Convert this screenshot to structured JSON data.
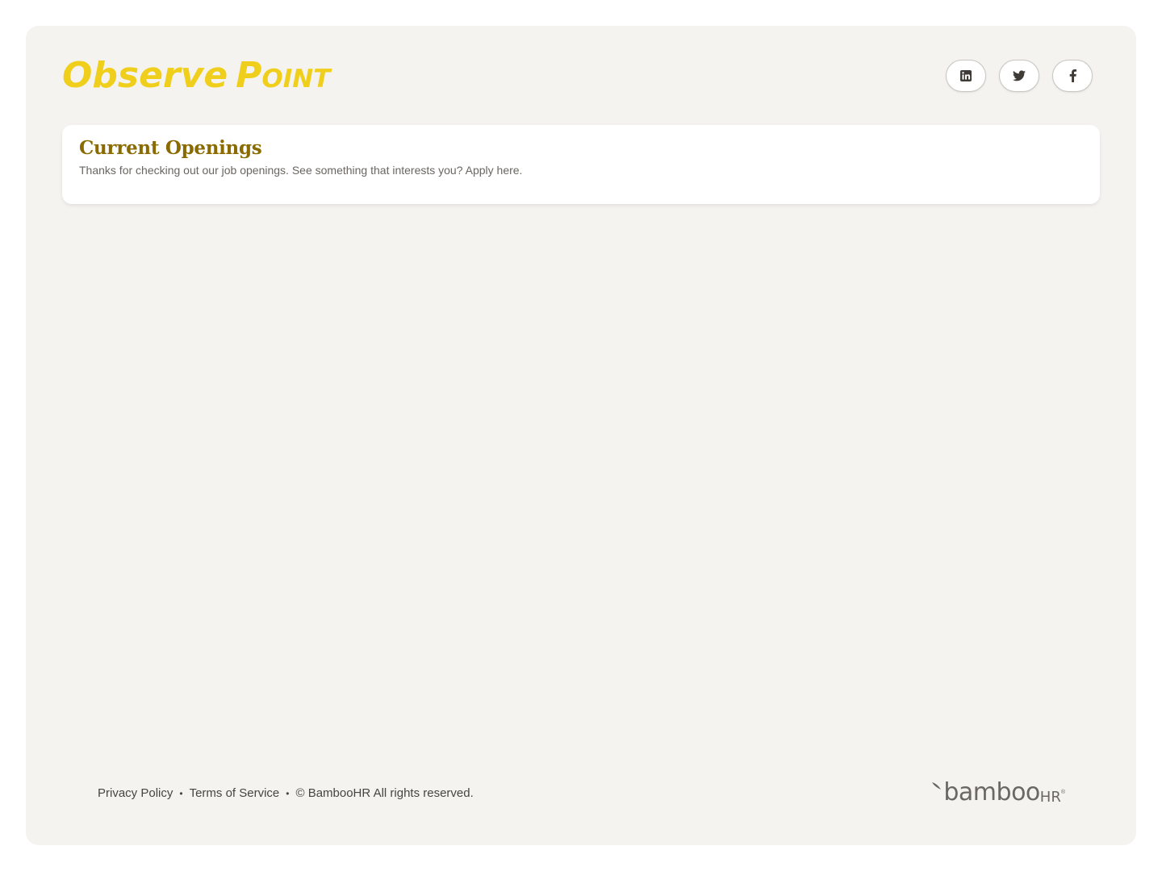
{
  "header": {
    "logo_word1": "Observe",
    "logo_word2": "Point",
    "social": [
      {
        "icon": "linkedin-icon"
      },
      {
        "icon": "twitter-icon"
      },
      {
        "icon": "facebook-icon"
      }
    ]
  },
  "openings": {
    "title": "Current Openings",
    "subtitle": "Thanks for checking out our job openings. See something that interests you? Apply here."
  },
  "footer": {
    "privacy": "Privacy Policy",
    "terms": "Terms of Service",
    "copyright": "© BambooHR All rights reserved.",
    "separator": "•",
    "brand_main": "bamboo",
    "brand_suffix": "HR",
    "brand_mark": "®"
  },
  "colors": {
    "brand_yellow": "#f0cf1c",
    "title_gold": "#8a6b00",
    "page_bg": "#f5f3f0"
  }
}
